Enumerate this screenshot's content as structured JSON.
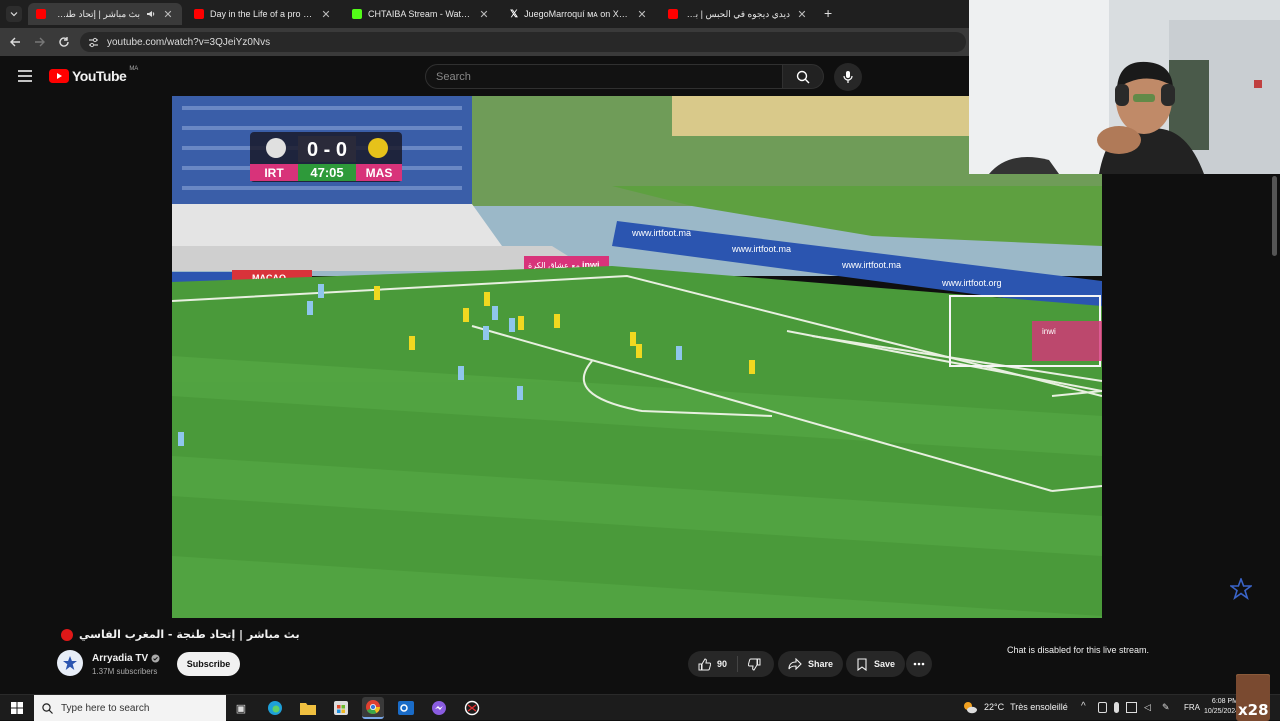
{
  "browser": {
    "tabs": [
      {
        "title": "بث مباشر | إتحاد طنجة -",
        "favicon": "youtube-favicon",
        "active": true
      },
      {
        "title": "Day in the Life of a pro football",
        "favicon": "youtube-favicon",
        "active": false
      },
      {
        "title": "CHTAIBA Stream - Watch Live o",
        "favicon": "kick-favicon",
        "active": false
      },
      {
        "title": "JuegoMarroquí ᴍᴀ on X: \"Azzed",
        "favicon": "x-favicon",
        "active": false
      },
      {
        "title": "ديدي ديجوه في الحبس | بنت كابر",
        "favicon": "youtube-favicon",
        "active": false
      }
    ],
    "new_tab": "+",
    "url": "youtube.com/watch?v=3QJeiYz0Nvs"
  },
  "youtube": {
    "logo_text": "YouTube",
    "region": "MA",
    "search_placeholder": "Search"
  },
  "scoreboard": {
    "home": "IRT",
    "away": "MAS",
    "score": "0 - 0",
    "clock": "47:05"
  },
  "ads": {
    "board_1": "www.irtfoot.ma",
    "board_2": "www.irtfoot.ma",
    "board_3": "www.irtfoot.ma",
    "board_4": "www.irtfoot.org",
    "inwi": "inwi",
    "inwi_slogan": "مع عشاق الكرة",
    "macao": "MACAO",
    "sider": "inwi"
  },
  "video_meta": {
    "title": "بث مباشر | إتحاد طنجة - المغرب الفاسي",
    "channel": "Arryadia TV",
    "subscribers": "1.37M subscribers",
    "subscribe_label": "Subscribe",
    "likes": "90",
    "share_label": "Share",
    "save_label": "Save",
    "chat_disabled": "Chat is disabled for this live stream."
  },
  "taskbar": {
    "search_placeholder": "Type here to search",
    "weather_temp": "22°C",
    "weather_desc": "Très ensoleillé",
    "language": "FRA",
    "time": "6:08 PM",
    "date": "10/25/2024",
    "overlay_text": "x28"
  },
  "colors": {
    "youtube_red": "#ff0000",
    "pitch_green": "#4a9a3a",
    "score_green": "#2e9a3a",
    "score_pink": "#d8337a"
  }
}
